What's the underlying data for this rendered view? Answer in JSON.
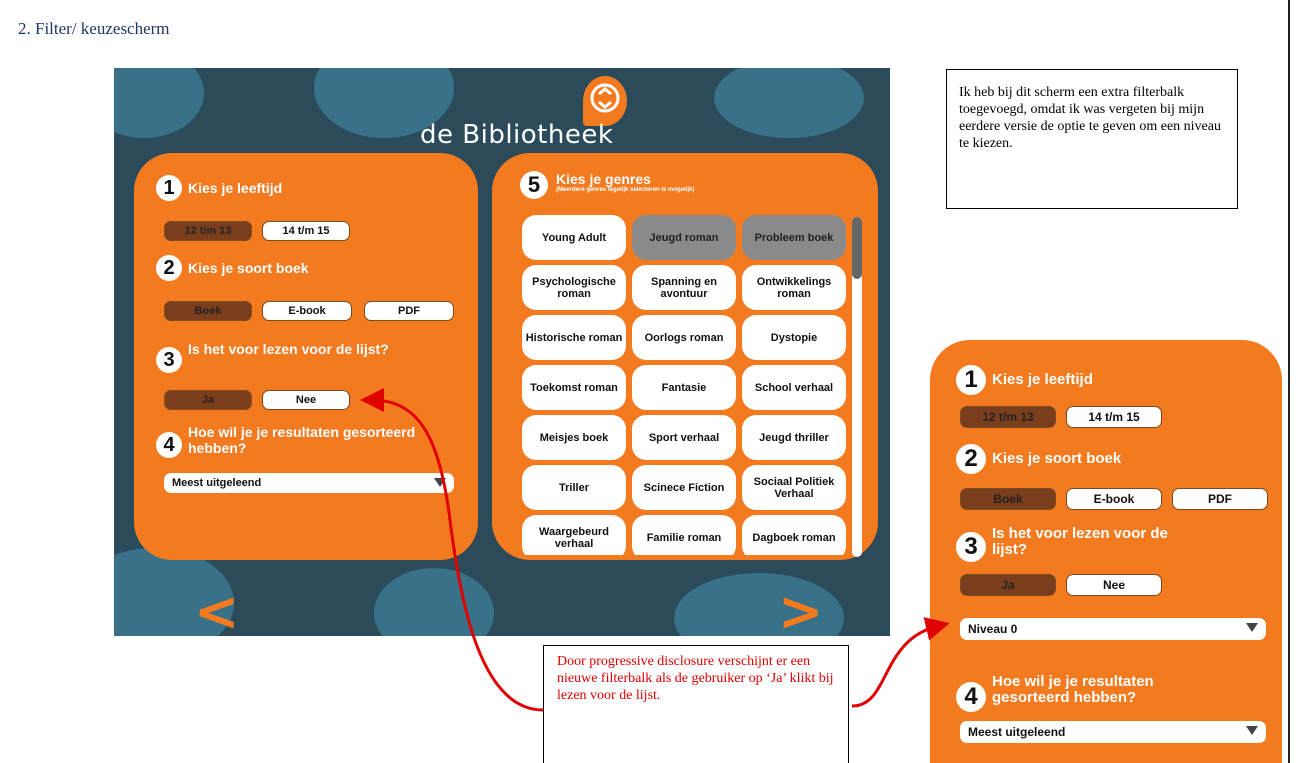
{
  "heading": "2. Filter/ keuzescherm",
  "app": {
    "title": "de Bibliotheek",
    "step1": {
      "number": "1",
      "question": "Kies je leeftijd",
      "options": [
        "12 t/m 13",
        "14 t/m 15"
      ],
      "selected": "12 t/m 13"
    },
    "step2": {
      "number": "2",
      "question": "Kies je soort boek",
      "options": [
        "Boek",
        "E-book",
        "PDF"
      ],
      "selected": "Boek"
    },
    "step3": {
      "number": "3",
      "question": "Is het voor lezen voor de lijst?",
      "options": [
        "Ja",
        "Nee"
      ],
      "selected": "Ja"
    },
    "step4": {
      "number": "4",
      "question": "Hoe wil je je resultaten gesorteerd hebben?",
      "sort_value": "Meest uitgeleend"
    },
    "step5": {
      "number": "5",
      "question": "Kies je genres",
      "subtitle": "(Meerdere genres tegelijk selecteren is mogelijk)",
      "genres": [
        "Young Adult",
        "Jeugd roman",
        "Probleem boek",
        "Psychologische roman",
        "Spanning en avontuur",
        "Ontwikkelings roman",
        "Historische roman",
        "Oorlogs roman",
        "Dystopie",
        "Toekomst roman",
        "Fantasie",
        "School verhaal",
        "Meisjes boek",
        "Sport verhaal",
        "Jeugd thriller",
        "Triller",
        "Scinece Fiction",
        "Sociaal Politiek Verhaal",
        "Waargebeurd verhaal",
        "Familie roman",
        "Dagboek roman"
      ],
      "selected_genres": [
        "Jeugd roman",
        "Probleem boek"
      ]
    }
  },
  "notes": {
    "top": "Ik heb bij dit scherm een extra filterbalk toegevoegd, omdat ik was vergeten bij mijn eerdere versie de optie te geven om een niveau te kiezen.",
    "bottom": "Door progressive disclosure verschijnt er een nieuwe filterbalk als de gebruiker op ‘Ja’ klikt bij lezen voor de lijst."
  },
  "zoom": {
    "niveau_value": "Niveau 0"
  },
  "colors": {
    "orange": "#f47a20",
    "selected_brown": "#7a3e1d",
    "annotation_red": "#e00000"
  }
}
